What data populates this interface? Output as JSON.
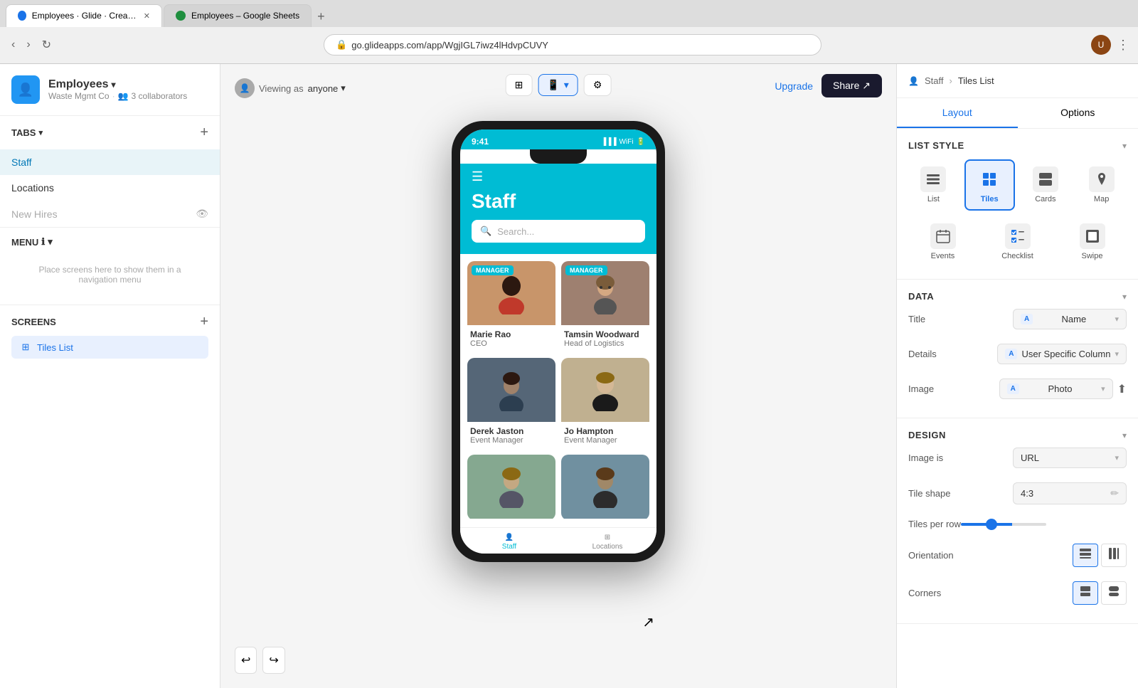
{
  "browser": {
    "tabs": [
      {
        "id": "glide",
        "label": "Employees · Glide · Create app...",
        "active": true,
        "favicon_color": "#1a73e8"
      },
      {
        "id": "sheets",
        "label": "Employees – Google Sheets",
        "active": false,
        "favicon_color": "#1e8e3e"
      }
    ],
    "address": "go.glideapps.com/app/WgjIGL7iwz4lHdvpCUVY",
    "new_tab_label": "+"
  },
  "header": {
    "app_icon": "👤",
    "app_name": "Employees",
    "app_name_dropdown": "▾",
    "app_subtitle": "Waste Mgmt Co",
    "collaborators": "3 collaborators",
    "upgrade_label": "Upgrade",
    "share_label": "Share ↗"
  },
  "toolbar": {
    "grid_icon": "⊞",
    "phone_icon": "📱",
    "settings_icon": "⚙"
  },
  "sidebar": {
    "tabs_label": "TABS",
    "tabs_dropdown": "▾",
    "nav_items": [
      {
        "id": "staff",
        "label": "Staff",
        "active": true
      },
      {
        "id": "locations",
        "label": "Locations",
        "active": false
      },
      {
        "id": "new_hires",
        "label": "New Hires",
        "active": false,
        "hidden": true
      }
    ],
    "menu_label": "MENU",
    "menu_info": "ℹ",
    "menu_dropdown": "▾",
    "menu_placeholder": "Place screens here to show them in a navigation menu",
    "screens_label": "SCREENS",
    "screens_items": [
      {
        "id": "tiles_list",
        "label": "Tiles List",
        "icon": "⊞"
      }
    ]
  },
  "canvas": {
    "viewing_text": "Viewing as",
    "viewing_value": "anyone",
    "viewing_dropdown": "▾"
  },
  "phone": {
    "time": "9:41",
    "app_title": "Staff",
    "search_placeholder": "Search...",
    "employees": [
      {
        "id": "marie",
        "name": "Marie Rao",
        "role": "CEO",
        "badge": "MANAGER",
        "photo_class": "photo-marie"
      },
      {
        "id": "tamsin",
        "name": "Tamsin Woodward",
        "role": "Head of Logistics",
        "badge": "MANAGER",
        "photo_class": "photo-tamsin"
      },
      {
        "id": "derek",
        "name": "Derek Jaston",
        "role": "Event Manager",
        "badge": null,
        "photo_class": "photo-derek"
      },
      {
        "id": "jo",
        "name": "Jo Hampton",
        "role": "Event Manager",
        "badge": null,
        "photo_class": "photo-jo"
      },
      {
        "id": "p5",
        "name": "",
        "role": "",
        "badge": null,
        "photo_class": "photo-p5"
      },
      {
        "id": "p6",
        "name": "",
        "role": "",
        "badge": null,
        "photo_class": "photo-p6"
      }
    ],
    "bottom_nav": [
      {
        "id": "staff",
        "label": "Staff",
        "icon": "👤",
        "active": true
      },
      {
        "id": "locations",
        "label": "Locations",
        "icon": "⊞",
        "active": false
      }
    ]
  },
  "right_panel": {
    "breadcrumb_parent": "Staff",
    "breadcrumb_current": "Tiles List",
    "tabs": [
      {
        "id": "layout",
        "label": "Layout",
        "active": true
      },
      {
        "id": "options",
        "label": "Options",
        "active": false
      }
    ],
    "list_style_label": "LIST STYLE",
    "style_options": [
      {
        "id": "list",
        "label": "List",
        "icon": "☰",
        "selected": false
      },
      {
        "id": "tiles",
        "label": "Tiles",
        "icon": "⊞",
        "selected": true
      },
      {
        "id": "cards",
        "label": "Cards",
        "icon": "▣",
        "selected": false
      },
      {
        "id": "map",
        "label": "Map",
        "icon": "📍",
        "selected": false
      },
      {
        "id": "events",
        "label": "Events",
        "icon": "📅",
        "selected": false
      },
      {
        "id": "checklist",
        "label": "Checklist",
        "icon": "✓",
        "selected": false
      },
      {
        "id": "swipe",
        "label": "Swipe",
        "icon": "◫",
        "selected": false
      }
    ],
    "data_label": "DATA",
    "data_fields": [
      {
        "id": "title",
        "label": "Title",
        "value": "Name",
        "prefix": "A"
      },
      {
        "id": "details",
        "label": "Details",
        "value": "User Specific Column",
        "prefix": "A"
      },
      {
        "id": "image",
        "label": "Image",
        "value": "Photo",
        "prefix": "A",
        "has_upload": true
      }
    ],
    "design_label": "DESIGN",
    "design_fields": [
      {
        "id": "image_is",
        "label": "Image is",
        "value": "URL"
      },
      {
        "id": "tile_shape",
        "label": "Tile shape",
        "value": "4:3"
      },
      {
        "id": "tiles_per_row",
        "label": "Tiles per row",
        "type": "slider"
      },
      {
        "id": "orientation",
        "label": "Orientation",
        "type": "buttons"
      },
      {
        "id": "corners",
        "label": "Corners",
        "type": "buttons"
      }
    ]
  }
}
